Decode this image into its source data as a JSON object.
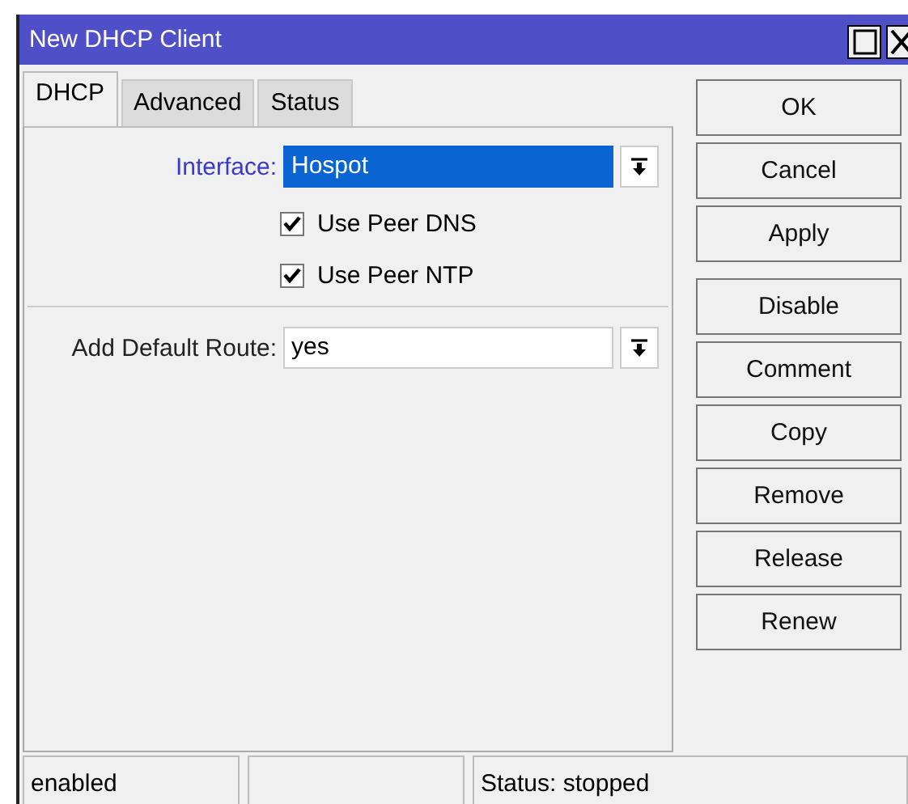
{
  "window": {
    "title": "New DHCP Client"
  },
  "tabs": [
    {
      "label": "DHCP",
      "selected": true
    },
    {
      "label": "Advanced",
      "selected": false
    },
    {
      "label": "Status",
      "selected": false
    }
  ],
  "fields": [
    {
      "kind": "select",
      "label": "Interface:",
      "value": "Hospot",
      "highlighted": true
    },
    {
      "kind": "checkbox",
      "label": "Use Peer DNS",
      "checked": true
    },
    {
      "kind": "checkbox",
      "label": "Use Peer NTP",
      "checked": true
    },
    {
      "kind": "separator"
    },
    {
      "kind": "select",
      "label": "Add Default Route:",
      "value": "yes",
      "highlighted": false
    }
  ],
  "button_groups": [
    [
      "OK",
      "Cancel",
      "Apply"
    ],
    [
      "Disable",
      "Comment",
      "Copy",
      "Remove",
      "Release",
      "Renew"
    ]
  ],
  "status_bar": {
    "state": "enabled",
    "status": "Status: stopped"
  }
}
